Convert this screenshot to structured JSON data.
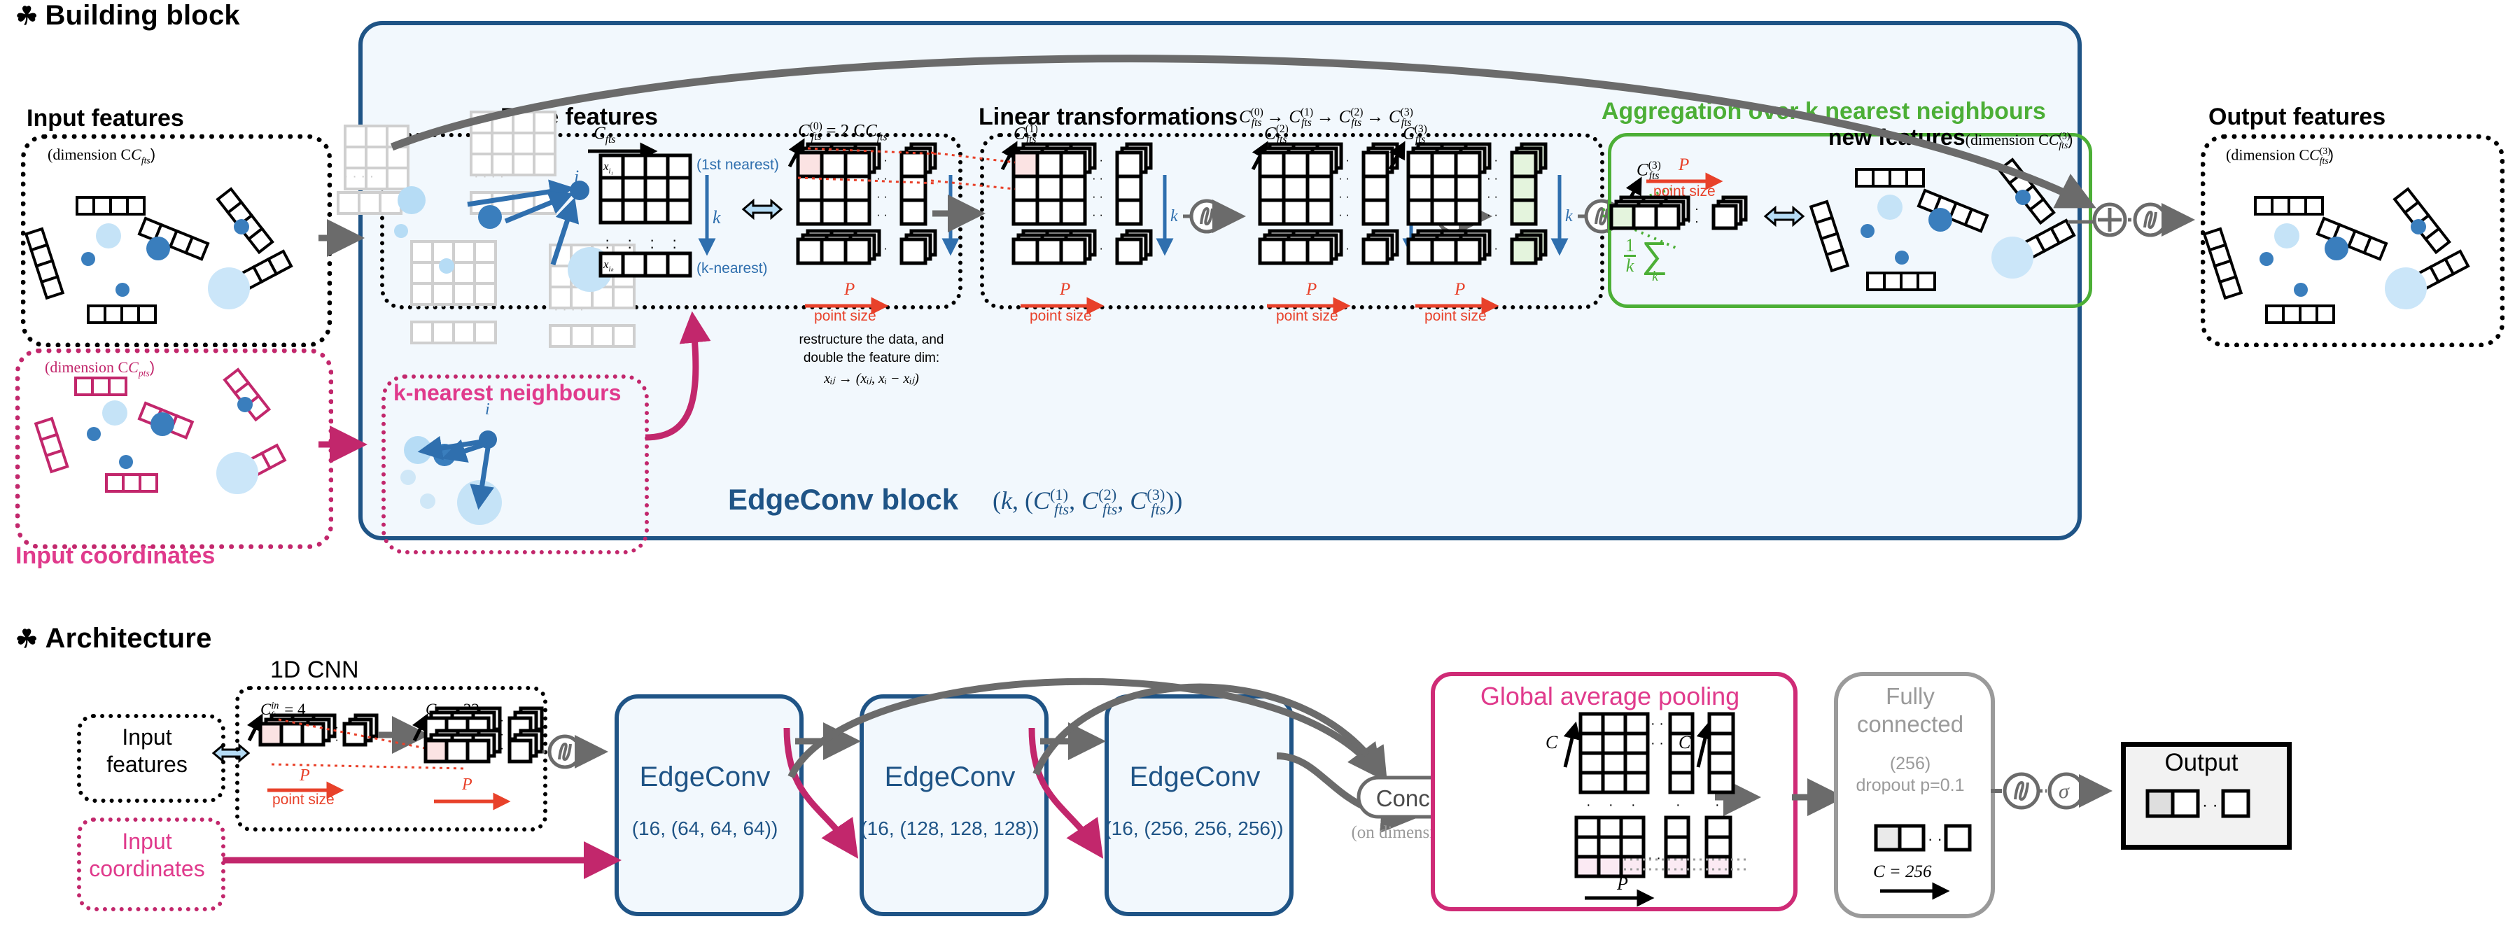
{
  "sections": {
    "building_block": {
      "bullet": "☘",
      "title": "Building block"
    },
    "architecture": {
      "bullet": "☘",
      "title": "Architecture"
    }
  },
  "building_block": {
    "input_features": {
      "title": "Input features",
      "dimension_label": "(dimension C",
      "dimension_sub": "fts",
      "dimension_close": ")"
    },
    "input_coordinates": {
      "title": "Input coordinates",
      "dimension_label": "(dimension C",
      "dimension_sub": "pts",
      "dimension_close": ")"
    },
    "edge_features": {
      "title": "Edge features",
      "axis_label": "C",
      "axis_sub": "fts",
      "node_label": "i",
      "row_first": "x",
      "row_first_sub": "i₁",
      "row_last": "x",
      "row_last_sub": "iₖ",
      "first_nearest": "(1st nearest)",
      "k_label": "k",
      "k_nearest": "(k-nearest)",
      "feature_dim_top": "C",
      "feature_dim_sup": "(0)",
      "feature_dim_sub": "fts",
      "feature_dim_eq": "= 2 C",
      "feature_dim_eq_sub": "fts",
      "p_label": "P",
      "point_size": "point size",
      "caption_line1": "restructure the data, and",
      "caption_line2": "double the feature dim:",
      "caption_formula": "xᵢⱼ → (xᵢⱼ, xᵢ − xᵢⱼ)"
    },
    "knn": {
      "title": "k-nearest neighbours",
      "node_label": "i"
    },
    "linear_transformations": {
      "title": "Linear transformations",
      "chain": "C(0)fts → C(1)fts → C(2)fts → C(3)fts",
      "stages": [
        {
          "sup": "(1)",
          "base": "C",
          "sub": "fts",
          "p_label": "P",
          "point_size": "point size",
          "k_label": "k"
        },
        {
          "sup": "(2)",
          "base": "C",
          "sub": "fts",
          "p_label": "P",
          "point_size": "point size",
          "k_label": "k"
        },
        {
          "sup": "(3)",
          "base": "C",
          "sub": "fts",
          "p_label": "P",
          "point_size": "point size",
          "k_label": "k"
        }
      ]
    },
    "aggregation": {
      "title": "Aggregation over k nearest neighbours",
      "axis_base": "C",
      "axis_sup": "(3)",
      "axis_sub": "fts",
      "p_label": "P",
      "point_size": "point size",
      "mean_numerator": "1",
      "mean_denominator": "k",
      "sum_symbol": "∑",
      "sum_sub": "k",
      "new_features": "new features",
      "new_features_dim_prefix": "(dimension C",
      "new_features_dim_sup": "(3)",
      "new_features_dim_sub": "fts",
      "new_features_dim_close": ")"
    },
    "output_features": {
      "title": "Output features",
      "dimension_prefix": "(dimension C",
      "dimension_sup": "(3)",
      "dimension_sub": "fts",
      "dimension_close": ")"
    },
    "block_label": {
      "name": "EdgeConv block",
      "params": "(k, (C(1)fts, C(2)fts, C(3)fts))"
    },
    "ops": {
      "add": "⊕",
      "activation": "∫"
    }
  },
  "architecture": {
    "input_features": {
      "line1": "Input",
      "line2": "features"
    },
    "input_coordinates": {
      "line1": "Input",
      "line2": "coordinates"
    },
    "cnn": {
      "title": "1D CNN",
      "in_base": "C",
      "in_sup": "in",
      "in_sub": "fts",
      "in_value": "= 4",
      "out_base": "C",
      "out_sub": "fts",
      "out_value": "= 32",
      "p_label": "P",
      "point_size": "point size",
      "p_label2": "P"
    },
    "edgeconv_blocks": [
      {
        "name": "EdgeConv",
        "params": "(16, (64, 64, 64))"
      },
      {
        "name": "EdgeConv",
        "params": "(16, (128, 128, 128))"
      },
      {
        "name": "EdgeConv",
        "params": "(16, (256, 256, 256))"
      }
    ],
    "concat": {
      "label": "Concat",
      "note": "(on dimension C)"
    },
    "global_pooling": {
      "title": "Global average pooling",
      "c_label": "C",
      "p_label": "P"
    },
    "fully_connected": {
      "line1": "Fully",
      "line2": "connected",
      "units": "(256)",
      "dropout": "dropout p=0.1",
      "c_value": "C = 256"
    },
    "output": {
      "title": "Output"
    },
    "ops": {
      "activation": "∫",
      "sigmoid": "σ"
    }
  },
  "colors": {
    "navy": "#1f5486",
    "block_bg": "#f2f8fd",
    "pink": "#c2276c",
    "magenta": "#e03a8c",
    "green": "#4caf36",
    "red": "#e8412a",
    "grey": "#9a9a9a",
    "blue_point": "#3a7ebd",
    "light_blue_point": "#b6dcf5"
  }
}
